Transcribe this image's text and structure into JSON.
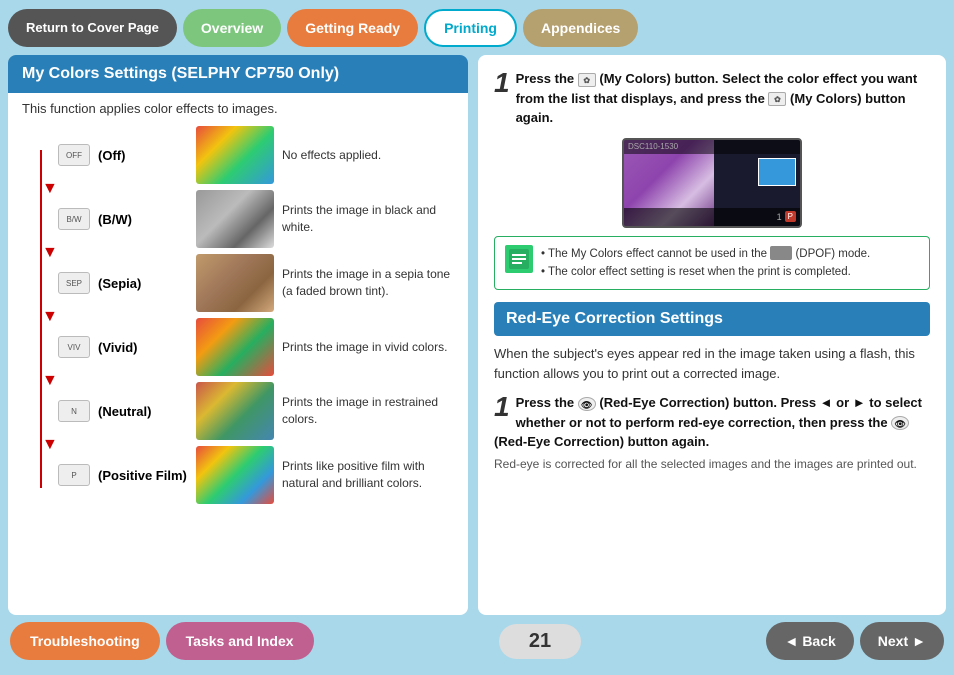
{
  "nav": {
    "return_label": "Return to Cover Page",
    "overview_label": "Overview",
    "getting_ready_label": "Getting Ready",
    "printing_label": "Printing",
    "appendices_label": "Appendices"
  },
  "left": {
    "title": "My Colors Settings (SELPHY CP750 Only)",
    "subtitle": "This function applies color effects to images.",
    "items": [
      {
        "icon": "OFF",
        "label": "(Off)",
        "description": "No effects applied.",
        "thumb_class": "thumb-off"
      },
      {
        "icon": "B/W",
        "label": "(B/W)",
        "description": "Prints the image in black and white.",
        "thumb_class": "thumb-bw"
      },
      {
        "icon": "SEP",
        "label": "(Sepia)",
        "description": "Prints the image in a sepia tone (a faded brown tint).",
        "thumb_class": "thumb-sepia"
      },
      {
        "icon": "VIV",
        "label": "(Vivid)",
        "description": "Prints the image in vivid colors.",
        "thumb_class": "thumb-vivid"
      },
      {
        "icon": "N",
        "label": "(Neutral)",
        "description": "Prints the image in restrained colors.",
        "thumb_class": "thumb-neutral"
      },
      {
        "icon": "P",
        "label": "(Positive Film)",
        "description": "Prints like positive film with natural and brilliant colors.",
        "thumb_class": "thumb-positive"
      }
    ]
  },
  "right": {
    "step1_num": "1",
    "step1_text": "Press the  (My Colors) button. Select the color effect you want from the list that displays, and press the  (My Colors) button again.",
    "note_lines": [
      "The My Colors effect cannot be used in the      (DPOF) mode.",
      "The color effect setting is reset when the print is completed."
    ],
    "red_eye_title": "Red-Eye Correction Settings",
    "red_eye_desc": "When the subject's eyes appear red in the image taken using a flash, this function allows you to print out a corrected image.",
    "step2_num": "1",
    "step2_text": "Press the  (Red-Eye Correction) button. Press ◄ or ► to select whether or not to perform red-eye correction, then press the  (Red-Eye Correction) button again.",
    "step2_sub": "Red-eye is corrected for all the selected images and the images are printed out."
  },
  "bottom": {
    "trouble_label": "Troubleshooting",
    "tasks_label": "Tasks and Index",
    "page_num": "21",
    "back_label": "Back",
    "next_label": "Next"
  }
}
